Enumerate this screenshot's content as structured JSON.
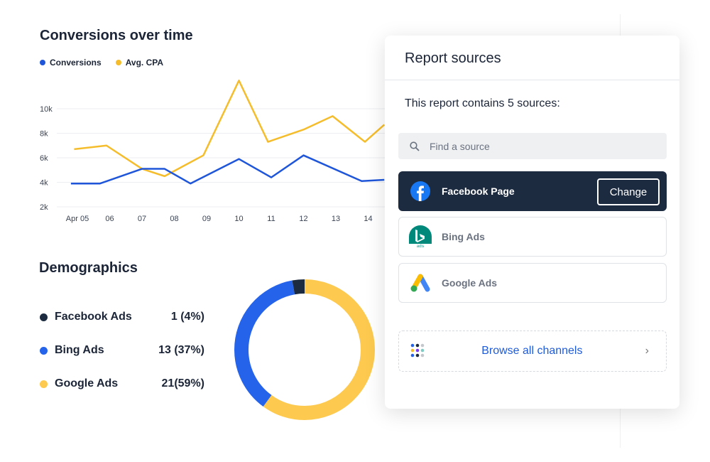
{
  "line_chart": {
    "title": "Conversions over time",
    "legend": [
      {
        "label": "Conversions",
        "color": "#1f56d9"
      },
      {
        "label": "Avg. CPA",
        "color": "#f5bd2c"
      }
    ],
    "chart_data": {
      "type": "line",
      "x_ticks": [
        "Apr 05",
        "06",
        "07",
        "08",
        "09",
        "10",
        "11",
        "12",
        "13",
        "14"
      ],
      "y_ticks": [
        "10k",
        "8k",
        "6k",
        "4k",
        "2k"
      ],
      "ylim": [
        2000,
        12500
      ],
      "grid": true,
      "series": [
        {
          "name": "Conversions",
          "color": "#1f56d9",
          "x": [
            4.8,
            5.7,
            7.0,
            7.7,
            8.5,
            10.0,
            11.0,
            12.0,
            13.8,
            14.5
          ],
          "y": [
            3900,
            3900,
            5100,
            5100,
            3900,
            5900,
            4400,
            6200,
            4100,
            4200
          ]
        },
        {
          "name": "Avg. CPA",
          "color": "#f5bd2c",
          "x": [
            4.9,
            5.9,
            7.0,
            7.7,
            8.9,
            10.0,
            10.9,
            12.0,
            12.9,
            13.9,
            14.5
          ],
          "y": [
            6700,
            7000,
            5100,
            4500,
            6200,
            12300,
            7300,
            8300,
            9400,
            7300,
            8700
          ]
        }
      ]
    }
  },
  "demographics": {
    "title": "Demographics",
    "items": [
      {
        "label": "Facebook Ads",
        "value": "1 (4%)",
        "count": 1,
        "color": "#1d2b40"
      },
      {
        "label": "Bing Ads",
        "value": "13 (37%)",
        "count": 13,
        "color": "#2563eb"
      },
      {
        "label": "Google Ads",
        "value": "21(59%)",
        "count": 21,
        "color": "#fdca4f"
      }
    ]
  },
  "panel": {
    "title": "Report sources",
    "subtitle": "This report contains 5 sources:",
    "search_placeholder": "Find a source",
    "sources": [
      {
        "label": "Facebook Page",
        "icon": "facebook-icon",
        "active": true,
        "action": "Change"
      },
      {
        "label": "Bing Ads",
        "icon": "bing-ads-icon"
      },
      {
        "label": "Google Ads",
        "icon": "google-ads-icon"
      }
    ],
    "browse_label": "Browse all channels"
  }
}
